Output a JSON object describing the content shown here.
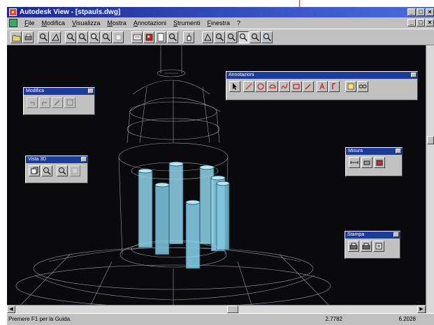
{
  "window": {
    "title": "Autodesk View - [stpauls.dwg]",
    "controls": [
      "_",
      "□",
      "×"
    ]
  },
  "menubar": {
    "items": [
      "File",
      "Modifica",
      "Visualizza",
      "Mostra",
      "Annotazioni",
      "Strumenti",
      "Finestra",
      "?"
    ],
    "doc_controls": [
      "_",
      "□",
      "×"
    ]
  },
  "toolbar": {
    "buttons": [
      "open-icon",
      "print-icon",
      "zoom-window-icon",
      "zoom-previous-icon",
      "zoom-in-icon",
      "zoom-out-icon",
      "zoom-extents-icon",
      "zoom-all-icon",
      "pan-icon",
      "redraw-icon",
      "named-views-icon",
      "layers-icon",
      "find-icon",
      "info-icon",
      "view-top-icon",
      "view-front-icon",
      "view-side-icon",
      "view-iso-icon",
      "zoom-fit-icon",
      "zoom-realtime-icon"
    ]
  },
  "palettes": {
    "modifica": {
      "title": "Modifica",
      "buttons": [
        "undo-icon",
        "redo-icon",
        "edit-icon",
        "markup-icon"
      ]
    },
    "vista3d": {
      "title": "Vista 3D",
      "buttons": [
        "orbit-icon",
        "zoom-3d-icon",
        "magnify-icon",
        "walk-icon"
      ]
    },
    "annotazioni": {
      "title": "Annotazioni",
      "buttons": [
        "select-arrow-icon",
        "line-icon",
        "circle-icon",
        "cloud-icon",
        "freehand-icon",
        "rectangle-icon",
        "pencil-icon",
        "text-icon",
        "highlight-icon",
        "note-icon",
        "link-icon"
      ]
    },
    "misura": {
      "title": "Misura",
      "buttons": [
        "measure-distance-icon",
        "measure-area-icon",
        "measure-scale-icon"
      ]
    },
    "stampa": {
      "title": "Stampa",
      "buttons": [
        "print-setup-icon",
        "print-icon",
        "print-preview-icon"
      ]
    }
  },
  "statusbar": {
    "help": "Premere F1 per la Guida.",
    "x": "2.7782",
    "y": "6.2028"
  },
  "colors": {
    "canvas": "#0a0a0c",
    "wireframe": "#c8ccd8",
    "columns": "#8fd3ea",
    "titlebar": "#1b2a8f"
  }
}
